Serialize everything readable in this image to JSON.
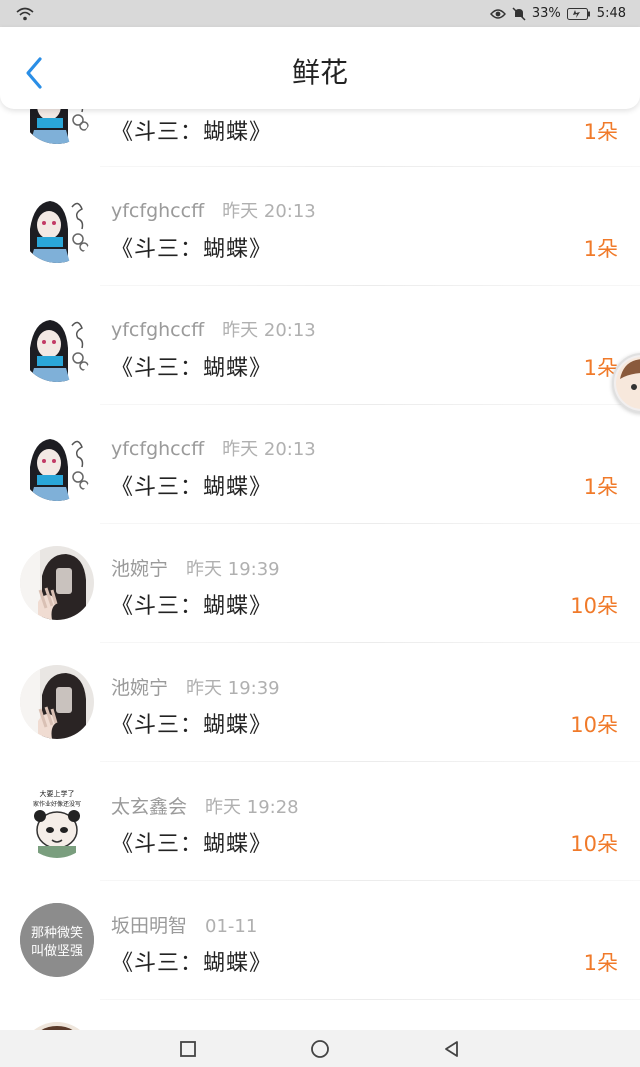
{
  "status_bar": {
    "battery": "33%",
    "time": "5:48"
  },
  "header": {
    "title": "鲜花"
  },
  "rows": [
    {
      "name": "",
      "time": "",
      "work": "《斗三：蝴蝶》",
      "amount": "1朵",
      "avatar": "anime-girl"
    },
    {
      "name": "yfcfghccff",
      "time": "昨天 20:13",
      "work": "《斗三：蝴蝶》",
      "amount": "1朵",
      "avatar": "anime-girl"
    },
    {
      "name": "yfcfghccff",
      "time": "昨天 20:13",
      "work": "《斗三：蝴蝶》",
      "amount": "1朵",
      "avatar": "anime-girl"
    },
    {
      "name": "yfcfghccff",
      "time": "昨天 20:13",
      "work": "《斗三：蝴蝶》",
      "amount": "1朵",
      "avatar": "anime-girl"
    },
    {
      "name": "池婉宁",
      "time": "昨天 19:39",
      "work": "《斗三：蝴蝶》",
      "amount": "10朵",
      "avatar": "photo-girl"
    },
    {
      "name": "池婉宁",
      "time": "昨天 19:39",
      "work": "《斗三：蝴蝶》",
      "amount": "10朵",
      "avatar": "photo-girl"
    },
    {
      "name": "太玄鑫会",
      "time": "昨天 19:28",
      "work": "《斗三：蝴蝶》",
      "amount": "10朵",
      "avatar": "cartoon-panda"
    },
    {
      "name": "坂田明智",
      "time": "01-11",
      "work": "《斗三：蝴蝶》",
      "amount": "1朵",
      "avatar": "text-avatar"
    }
  ],
  "avatar_text": {
    "cartoon_top": "大要上学了",
    "cartoon_sub": "家作业好像还没写",
    "gray_line1": "那种微笑",
    "gray_line2": "叫做坚强"
  },
  "icons": {
    "back": "chevron-left-icon",
    "nav_recent": "square-icon",
    "nav_home": "circle-icon",
    "nav_back": "triangle-back-icon"
  },
  "colors": {
    "accent_blue": "#2a8ee6",
    "amount_orange": "#f07a2a"
  }
}
